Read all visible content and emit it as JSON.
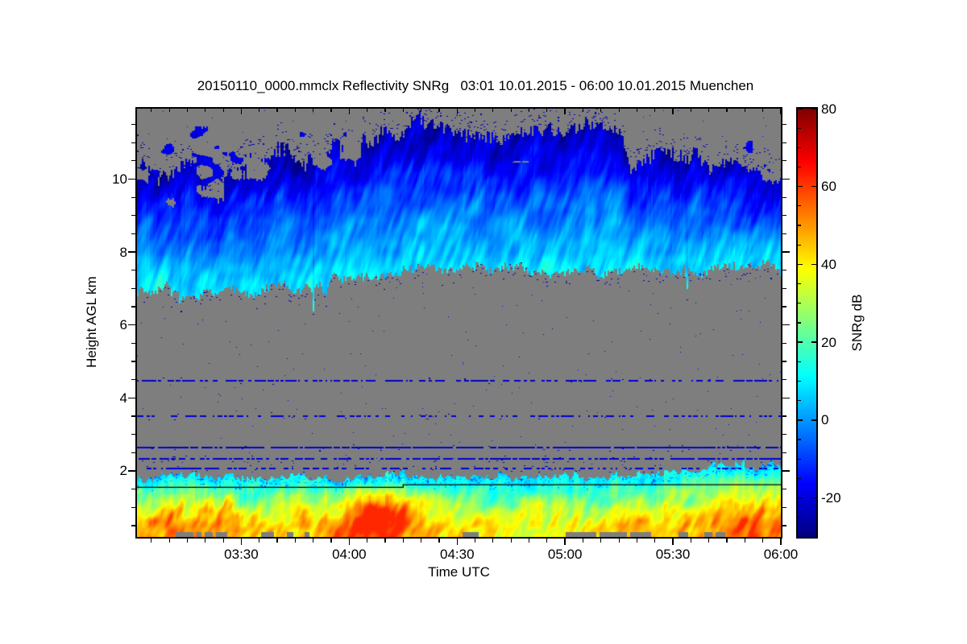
{
  "figure": {
    "title": "20150110_0000.mmclx Reflectivity SNRg   03:01 10.01.2015 - 06:00 10.01.2015 Muenchen",
    "background": "#ffffff"
  },
  "chart_data": {
    "type": "heatmap",
    "title": "20150110_0000.mmclx Reflectivity SNRg   03:01 10.01.2015 - 06:00 10.01.2015 Muenchen",
    "station": "Muenchen",
    "time_start": "03:01 10.01.2015",
    "time_end": "06:00 10.01.2015",
    "xlabel": "Time UTC",
    "ylabel": "Height AGL km",
    "colorbar_label": "SNRg dB",
    "x_span_minutes": 179,
    "x_major_ticks": [
      {
        "label": "03:30",
        "minute": 29
      },
      {
        "label": "04:00",
        "minute": 59
      },
      {
        "label": "04:30",
        "minute": 89
      },
      {
        "label": "05:00",
        "minute": 119
      },
      {
        "label": "05:30",
        "minute": 149
      },
      {
        "label": "06:00",
        "minute": 179
      }
    ],
    "x_first_minor_minute": 4,
    "x_minor_step_minutes": 5,
    "y_range_km": [
      0.19,
      11.93
    ],
    "y_major_ticks": [
      {
        "label": "2",
        "km": 2
      },
      {
        "label": "4",
        "km": 4
      },
      {
        "label": "6",
        "km": 6
      },
      {
        "label": "8",
        "km": 8
      },
      {
        "label": "10",
        "km": 10
      }
    ],
    "y_minor_step_km": 0.5,
    "colorbar": {
      "min_db": -30,
      "max_db": 80,
      "major_ticks": [
        {
          "label": "80",
          "db": 80
        },
        {
          "label": "60",
          "db": 60
        },
        {
          "label": "40",
          "db": 40
        },
        {
          "label": "20",
          "db": 20
        },
        {
          "label": "0",
          "db": 0
        },
        {
          "label": "-20",
          "db": -20
        }
      ],
      "minor_step_db": 5,
      "colormap": "jet"
    },
    "no_data_color": "#7e7e7e",
    "frame_color": "#000000",
    "upper_cloud": {
      "top_km": [
        [
          0,
          10.35
        ],
        [
          6,
          9.9
        ],
        [
          10,
          10.1
        ],
        [
          14,
          10.55
        ],
        [
          18,
          9.9
        ],
        [
          22,
          9.7
        ],
        [
          27,
          10.4
        ],
        [
          31,
          10.75
        ],
        [
          36,
          10.5
        ],
        [
          41,
          10.9
        ],
        [
          46,
          10.45
        ],
        [
          50,
          10.8
        ],
        [
          55,
          11.15
        ],
        [
          60,
          10.95
        ],
        [
          64,
          11.15
        ],
        [
          68,
          11.3
        ],
        [
          73,
          11.2
        ],
        [
          78,
          11.65
        ],
        [
          83,
          11.55
        ],
        [
          88,
          11.35
        ],
        [
          93,
          11.25
        ],
        [
          98,
          11.15
        ],
        [
          103,
          11.3
        ],
        [
          108,
          11.5
        ],
        [
          113,
          11.35
        ],
        [
          118,
          11.25
        ],
        [
          122,
          11.4
        ],
        [
          127,
          11.55
        ],
        [
          131,
          11.5
        ],
        [
          134,
          11.25
        ],
        [
          137,
          10.45
        ],
        [
          140,
          10.55
        ],
        [
          144,
          10.75
        ],
        [
          148,
          10.6
        ],
        [
          152,
          10.45
        ],
        [
          156,
          10.6
        ],
        [
          160,
          10.35
        ],
        [
          164,
          10.5
        ],
        [
          168,
          10.2
        ],
        [
          172,
          10.45
        ],
        [
          176,
          10.1
        ],
        [
          179,
          10.15
        ]
      ],
      "base_km": [
        [
          0,
          6.85
        ],
        [
          8,
          7.0
        ],
        [
          16,
          6.75
        ],
        [
          24,
          6.95
        ],
        [
          32,
          6.9
        ],
        [
          40,
          7.0
        ],
        [
          48,
          7.1
        ],
        [
          56,
          7.2
        ],
        [
          64,
          7.35
        ],
        [
          72,
          7.45
        ],
        [
          80,
          7.55
        ],
        [
          88,
          7.6
        ],
        [
          96,
          7.55
        ],
        [
          104,
          7.5
        ],
        [
          112,
          7.45
        ],
        [
          120,
          7.4
        ],
        [
          128,
          7.45
        ],
        [
          136,
          7.5
        ],
        [
          144,
          7.55
        ],
        [
          152,
          7.45
        ],
        [
          160,
          7.55
        ],
        [
          168,
          7.5
        ],
        [
          174,
          7.6
        ],
        [
          179,
          7.55
        ]
      ],
      "snr_top_db": -25,
      "snr_base_db": 9
    },
    "boundary_layer": {
      "top_km": [
        [
          0,
          1.82
        ],
        [
          10,
          1.88
        ],
        [
          20,
          1.85
        ],
        [
          30,
          1.8
        ],
        [
          40,
          1.85
        ],
        [
          50,
          1.8
        ],
        [
          60,
          1.78
        ],
        [
          70,
          1.92
        ],
        [
          78,
          1.85
        ],
        [
          88,
          1.8
        ],
        [
          98,
          1.84
        ],
        [
          108,
          1.8
        ],
        [
          118,
          1.86
        ],
        [
          128,
          1.82
        ],
        [
          138,
          1.9
        ],
        [
          148,
          1.95
        ],
        [
          155,
          2.05
        ],
        [
          162,
          2.15
        ],
        [
          168,
          2.25
        ],
        [
          172,
          2.1
        ],
        [
          176,
          2.2
        ],
        [
          179,
          2.15
        ]
      ],
      "envelope_db": [
        [
          0,
          6
        ],
        [
          8,
          9
        ],
        [
          15,
          8
        ],
        [
          25,
          7
        ],
        [
          35,
          6
        ],
        [
          45,
          8
        ],
        [
          52,
          9
        ],
        [
          58,
          12
        ],
        [
          63,
          16
        ],
        [
          68,
          15
        ],
        [
          73,
          11
        ],
        [
          78,
          7
        ],
        [
          84,
          4
        ],
        [
          92,
          2
        ],
        [
          100,
          3
        ],
        [
          108,
          2
        ],
        [
          116,
          3
        ],
        [
          124,
          2
        ],
        [
          132,
          3
        ],
        [
          140,
          2
        ],
        [
          148,
          4
        ],
        [
          156,
          5
        ],
        [
          163,
          7
        ],
        [
          170,
          9
        ],
        [
          179,
          10
        ]
      ],
      "cores": [
        {
          "t": 14,
          "amp": 8,
          "st": 10,
          "h": 0.85,
          "sh": 0.55
        },
        {
          "t": 64,
          "amp": 15,
          "st": 7,
          "h": 0.6,
          "sh": 0.5
        },
        {
          "t": 70,
          "amp": 11,
          "st": 5,
          "h": 0.95,
          "sh": 0.5
        },
        {
          "t": 151,
          "amp": 5,
          "st": 12,
          "h": 0.3,
          "sh": 0.35
        },
        {
          "t": 171,
          "amp": 10,
          "st": 7,
          "h": 0.35,
          "sh": 0.4
        }
      ]
    },
    "speckle_lines": [
      {
        "km": 4.47,
        "on_fraction": 0.55,
        "scatter": 0.004
      },
      {
        "km": 3.5,
        "on_fraction": 0.5,
        "scatter": 0.004
      },
      {
        "km": 2.63,
        "on_fraction": 0.78,
        "scatter": 0.012
      },
      {
        "km": 2.32,
        "on_fraction": 0.68,
        "scatter": 0.012
      },
      {
        "km": 2.06,
        "on_fraction": 0.5,
        "scatter": 0.015
      }
    ],
    "surface_mask_minutes": [
      [
        10.5,
        15.5
      ],
      [
        16.5,
        17.5
      ],
      [
        18.6,
        20.9
      ],
      [
        21.8,
        24.7
      ],
      [
        34.3,
        37.7
      ],
      [
        41.5,
        43.3
      ],
      [
        46.4,
        47.8
      ],
      [
        90.4,
        94.9
      ],
      [
        118.9,
        127.5
      ],
      [
        128.5,
        136
      ],
      [
        137,
        142.9
      ],
      [
        150.3,
        153.2
      ],
      [
        157.7,
        159.8
      ],
      [
        160.8,
        163.1
      ]
    ],
    "freezing_line": {
      "left_km": 1.55,
      "right_km": 1.62,
      "step_minute": 74
    }
  }
}
